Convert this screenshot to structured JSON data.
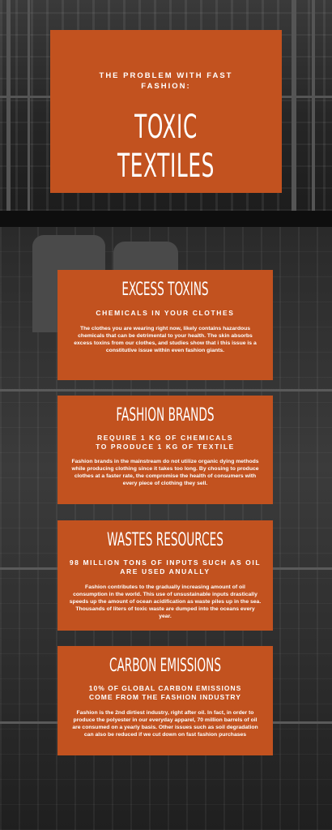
{
  "hero": {
    "kicker": "THE PROBLEM WITH FAST FASHION:",
    "title": "TOXIC TEXTILES"
  },
  "sections": [
    {
      "title": "EXCESS TOXINS",
      "subtitle": "CHEMICALS IN YOUR CLOTHES",
      "body": "The clothes you are wearing right now, likely contains hazardous chemicals that can be detrimental to your  health. The skin absorbs excess toxins from our clothes, and studies show that i this issue is a constitutive issue within even fashion giants."
    },
    {
      "title": "FASHION BRANDS",
      "subtitle": "REQUIRE 1 KG OF CHEMICALS TO PRODUCE 1 KG OF TEXTILE",
      "body": "Fashion brands in the mainstream do not utilize organic dying methods while producing clothing since it takes too long. By chosing to produce clothes at a faster rate, the compromise the health of consumers with every piece of clothing they sell."
    },
    {
      "title": "WASTES RESOURCES",
      "subtitle": "98 MILLION TONS OF INPUTS SUCH AS OIL ARE USED ANUALLY",
      "body": "Fashion contributes to the gradually increasing amount of oil consumption in the world. This use of unsustainable inputs drastically speeds up the amount of ocean acidification as waste piles up in the sea. Thousands of liters of toxic waste are dumped into the oceans every year."
    },
    {
      "title": "CARBON EMISSIONS",
      "subtitle": "10% OF GLOBAL CARBON EMISSIONS COME FROM THE FASHION INDUSTRY",
      "body": "Fashion is the 2nd dirtiest industry, right after oil. In fact, in order to produce the polyester in our everyday apparel, 70 million barrels of oil are consumed on a yearly basis. Other issues such as soil degradation can also be reduced if we cut down on fast fashion purchases"
    }
  ],
  "colors": {
    "accent": "#c2521f",
    "background": "#161616"
  }
}
